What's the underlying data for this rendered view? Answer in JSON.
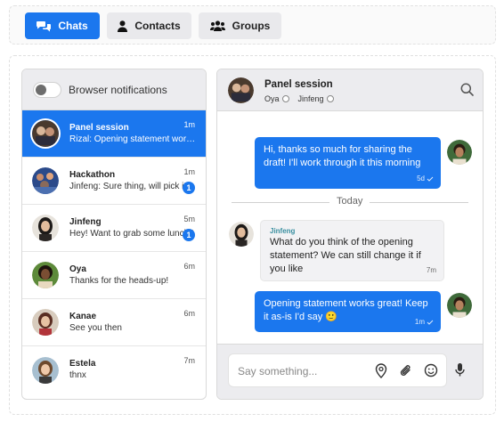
{
  "nav": {
    "chats_label": "Chats",
    "contacts_label": "Contacts",
    "groups_label": "Groups"
  },
  "sidebar": {
    "notifications_label": "Browser notifications",
    "conversations": [
      {
        "name": "Panel session",
        "preview": "Rizal: Opening statement works great! Keep it as-is I'd say",
        "time": "1m",
        "unread": "",
        "active": true
      },
      {
        "name": "Hackathon",
        "preview": "Jinfeng: Sure thing, will pick it up",
        "time": "1m",
        "unread": "1"
      },
      {
        "name": "Jinfeng",
        "preview": "Hey! Want to grab some lunch?",
        "time": "5m",
        "unread": "1"
      },
      {
        "name": "Oya",
        "preview": "Thanks for the heads-up!",
        "time": "6m",
        "unread": ""
      },
      {
        "name": "Kanae",
        "preview": "See you then",
        "time": "6m",
        "unread": ""
      },
      {
        "name": "Estela",
        "preview": "thnx",
        "time": "7m",
        "unread": ""
      }
    ]
  },
  "chat": {
    "title": "Panel session",
    "participants": [
      "Oya",
      "Jinfeng"
    ],
    "messages": [
      {
        "text": "Hi, thanks so much for sharing the draft! I'll work through it this morning",
        "time": "5d"
      },
      {
        "sender": "Jinfeng",
        "text": "What do you think of the opening statement? We can still change it if you like",
        "time": "7m"
      },
      {
        "text": "Opening statement works great! Keep it as-is I'd say 🙂",
        "time": "1m"
      }
    ],
    "divider_label": "Today",
    "input_placeholder": "Say something..."
  },
  "colors": {
    "accent": "#1b77ee",
    "header_bg": "#ececef"
  }
}
